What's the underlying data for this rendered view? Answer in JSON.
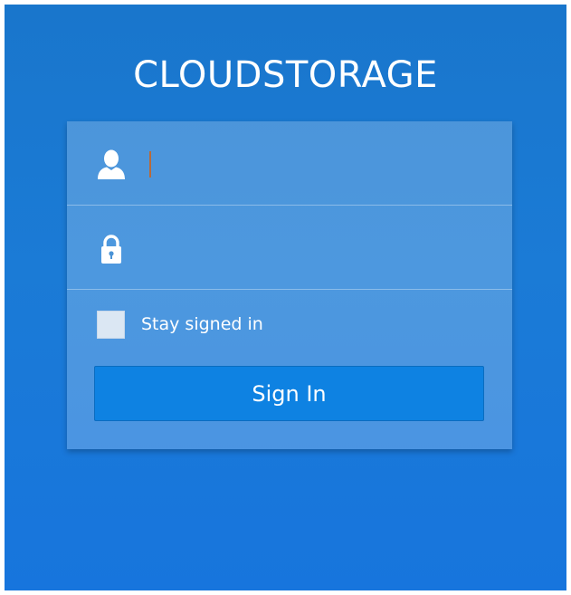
{
  "app": {
    "title": "CLOUDSTORAGE"
  },
  "login": {
    "username": {
      "icon": "user-icon",
      "value": "",
      "placeholder": ""
    },
    "password": {
      "icon": "lock-icon",
      "value": "",
      "placeholder": ""
    },
    "stay_signed_in": {
      "label": "Stay signed in",
      "checked": false
    },
    "sign_in_label": "Sign In"
  },
  "colors": {
    "background": "#1b7bd6",
    "button": "#0e82e2",
    "text": "#ffffff"
  }
}
